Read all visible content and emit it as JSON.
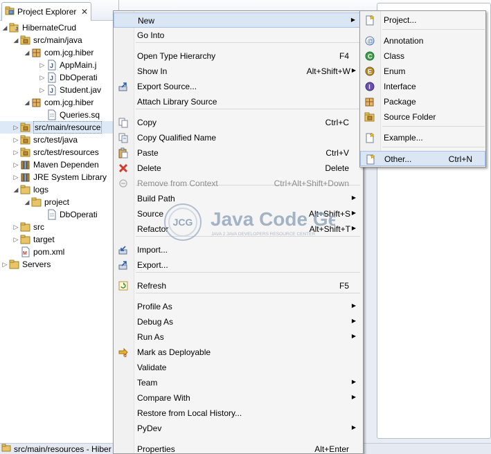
{
  "explorer": {
    "tab_title": "Project Explorer",
    "tree": [
      {
        "label": "HibernateCrud",
        "icon": "project-icon",
        "twisty": "open"
      },
      {
        "label": "src/main/java",
        "icon": "source-folder-icon",
        "twisty": "open"
      },
      {
        "label": "com.jcg.hiber",
        "icon": "package-icon",
        "twisty": "open"
      },
      {
        "label": "AppMain.j",
        "icon": "java-file-icon",
        "twisty": "closed"
      },
      {
        "label": "DbOperati",
        "icon": "java-file-icon",
        "twisty": "closed"
      },
      {
        "label": "Student.jav",
        "icon": "java-file-icon",
        "twisty": "closed"
      },
      {
        "label": "com.jcg.hiber",
        "icon": "package-icon",
        "twisty": "open"
      },
      {
        "label": "Queries.sq",
        "icon": "file-icon",
        "twisty": "none"
      },
      {
        "label": "src/main/resource",
        "icon": "source-folder-icon",
        "twisty": "closed"
      },
      {
        "label": "src/test/java",
        "icon": "source-folder-icon",
        "twisty": "closed"
      },
      {
        "label": "src/test/resources",
        "icon": "source-folder-icon",
        "twisty": "closed"
      },
      {
        "label": "Maven Dependen",
        "icon": "library-icon",
        "twisty": "closed"
      },
      {
        "label": "JRE System Library",
        "icon": "library-icon",
        "twisty": "closed"
      },
      {
        "label": "logs",
        "icon": "folder-icon",
        "twisty": "open"
      },
      {
        "label": "project",
        "icon": "folder-icon",
        "twisty": "open"
      },
      {
        "label": "DbOperati",
        "icon": "file-icon",
        "twisty": "none"
      },
      {
        "label": "src",
        "icon": "folder-icon",
        "twisty": "closed"
      },
      {
        "label": "target",
        "icon": "folder-icon",
        "twisty": "closed"
      },
      {
        "label": "pom.xml",
        "icon": "xml-file-icon",
        "twisty": "none"
      },
      {
        "label": "Servers",
        "icon": "folder-icon",
        "twisty": "closed"
      }
    ]
  },
  "statusbar": {
    "text": "src/main/resources - Hiber"
  },
  "context_menu": {
    "items": [
      {
        "label": "New",
        "key": "",
        "submenu": true,
        "icon": ""
      },
      {
        "label": "Go Into",
        "key": "",
        "submenu": false,
        "icon": ""
      },
      {
        "label": "Open Type Hierarchy",
        "key": "F4",
        "submenu": false,
        "icon": ""
      },
      {
        "label": "Show In",
        "key": "Alt+Shift+W",
        "submenu": true,
        "icon": ""
      },
      {
        "label": "Export Source...",
        "key": "",
        "submenu": false,
        "icon": "export-source-icon"
      },
      {
        "label": "Attach Library Source",
        "key": "",
        "submenu": false,
        "icon": ""
      },
      {
        "label": "Copy",
        "key": "Ctrl+C",
        "submenu": false,
        "icon": "copy-icon"
      },
      {
        "label": "Copy Qualified Name",
        "key": "",
        "submenu": false,
        "icon": "copy-qualified-icon"
      },
      {
        "label": "Paste",
        "key": "Ctrl+V",
        "submenu": false,
        "icon": "paste-icon"
      },
      {
        "label": "Delete",
        "key": "Delete",
        "submenu": false,
        "icon": "delete-icon"
      },
      {
        "label": "Remove from Context",
        "key": "Ctrl+Alt+Shift+Down",
        "submenu": false,
        "icon": "remove-context-icon",
        "disabled": true
      },
      {
        "label": "Build Path",
        "key": "",
        "submenu": true,
        "icon": ""
      },
      {
        "label": "Source",
        "key": "Alt+Shift+S",
        "submenu": true,
        "icon": ""
      },
      {
        "label": "Refactor",
        "key": "Alt+Shift+T",
        "submenu": true,
        "icon": ""
      },
      {
        "label": "Import...",
        "key": "",
        "submenu": false,
        "icon": "import-icon"
      },
      {
        "label": "Export...",
        "key": "",
        "submenu": false,
        "icon": "export-icon"
      },
      {
        "label": "Refresh",
        "key": "F5",
        "submenu": false,
        "icon": "refresh-icon"
      },
      {
        "label": "Profile As",
        "key": "",
        "submenu": true,
        "icon": ""
      },
      {
        "label": "Debug As",
        "key": "",
        "submenu": true,
        "icon": ""
      },
      {
        "label": "Run As",
        "key": "",
        "submenu": true,
        "icon": ""
      },
      {
        "label": "Mark as Deployable",
        "key": "",
        "submenu": false,
        "icon": "deployable-icon"
      },
      {
        "label": "Validate",
        "key": "",
        "submenu": false,
        "icon": ""
      },
      {
        "label": "Team",
        "key": "",
        "submenu": true,
        "icon": ""
      },
      {
        "label": "Compare With",
        "key": "",
        "submenu": true,
        "icon": ""
      },
      {
        "label": "Restore from Local History...",
        "key": "",
        "submenu": false,
        "icon": ""
      },
      {
        "label": "PyDev",
        "key": "",
        "submenu": true,
        "icon": ""
      },
      {
        "label": "Properties",
        "key": "Alt+Enter",
        "submenu": false,
        "icon": ""
      }
    ]
  },
  "new_submenu": {
    "items": [
      {
        "label": "Project...",
        "key": "",
        "icon": "new-project-icon"
      },
      {
        "label": "Annotation",
        "key": "",
        "icon": "annotation-icon"
      },
      {
        "label": "Class",
        "key": "",
        "icon": "class-icon"
      },
      {
        "label": "Enum",
        "key": "",
        "icon": "enum-icon"
      },
      {
        "label": "Interface",
        "key": "",
        "icon": "interface-icon"
      },
      {
        "label": "Package",
        "key": "",
        "icon": "package-icon"
      },
      {
        "label": "Source Folder",
        "key": "",
        "icon": "source-folder-icon"
      },
      {
        "label": "Example...",
        "key": "",
        "icon": "example-icon"
      },
      {
        "label": "Other...",
        "key": "Ctrl+N",
        "icon": "other-wizard-icon"
      }
    ]
  },
  "watermark": {
    "logo_text": "JCG",
    "title": "Java Code Geeks",
    "tagline": "JAVA 2 JAVA DEVELOPERS RESOURCE CENTER"
  },
  "colors": {
    "selection": "#dbe6f5",
    "menu_bg": "#f5f5f5",
    "tree_selection": "#dde9f7"
  }
}
